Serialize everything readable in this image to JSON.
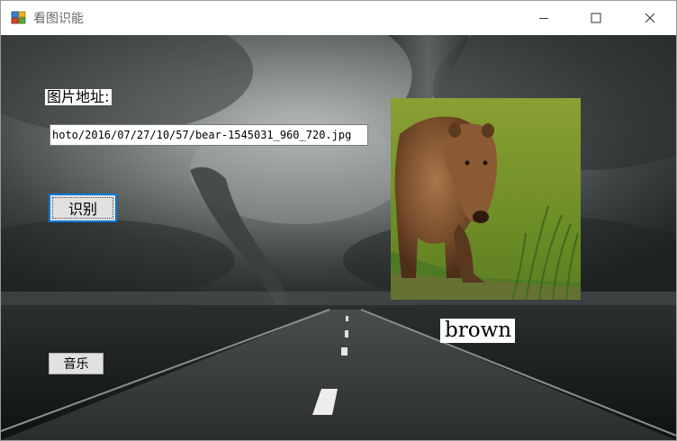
{
  "window": {
    "title": "看图识能",
    "controls": [
      "minimize-icon",
      "maximize-icon",
      "close-icon"
    ]
  },
  "form": {
    "address_label": "图片地址:",
    "url_value": "hoto/2016/07/27/10/57/bear-1545031_960_720.jpg",
    "recognize_button": "识别",
    "music_button": "音乐",
    "result": "brown"
  },
  "image": {
    "subject": "brown bear on grass"
  },
  "colors": {
    "focus_border": "#0078d7",
    "button_face": "#e1e1e1"
  }
}
